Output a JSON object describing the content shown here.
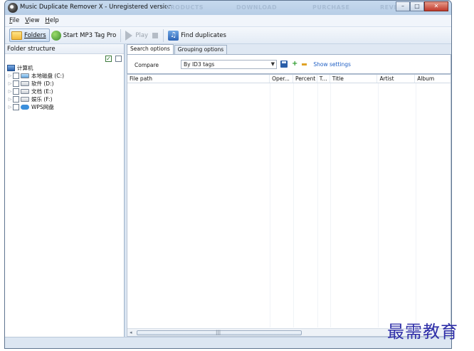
{
  "window": {
    "title": "Music Duplicate Remover X - Unregistered version",
    "background_nav": [
      "PRODUCTS",
      "DOWNLOAD",
      "PURCHASE",
      "REVIEW"
    ],
    "controls": {
      "minimize": "–",
      "maximize": "□",
      "close": "✕"
    }
  },
  "menu": [
    "File",
    "View",
    "Help"
  ],
  "toolbar": {
    "folders": "Folders",
    "start_mp3": "Start MP3 Tag Pro",
    "play": "Play",
    "find_duplicates": "Find duplicates"
  },
  "folder_pane": {
    "header": "Folder structure",
    "root": "计算机",
    "drives": [
      {
        "label": "本地磁盘 (C:)",
        "icon": "system-drive-icon"
      },
      {
        "label": "软件 (D:)",
        "icon": "drive-icon"
      },
      {
        "label": "文档 (E:)",
        "icon": "drive-icon"
      },
      {
        "label": "娱乐 (F:)",
        "icon": "drive-icon"
      },
      {
        "label": "WPS网盘",
        "icon": "cloud-icon"
      }
    ]
  },
  "search": {
    "tabs": [
      "Search options",
      "Grouping options"
    ],
    "selected_tab": "Search options",
    "compare_label": "Compare",
    "compare_value": "By ID3 tags",
    "show_settings": "Show settings"
  },
  "table": {
    "columns": [
      "File path",
      "Oper...",
      "Percent",
      "T...",
      "Title",
      "Artist",
      "Album"
    ],
    "rows": []
  },
  "scrollbar": {
    "left": "◂",
    "grip": "|||"
  },
  "watermark": "最需教育",
  "colors": {
    "accent": "#1f5fc4",
    "chrome": "#cbdcee",
    "watermark": "#2f2fa8"
  }
}
